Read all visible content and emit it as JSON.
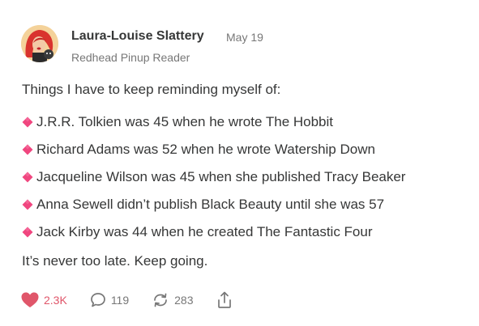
{
  "post": {
    "author": {
      "name": "Laura-Louise Slattery",
      "subtitle": "Redhead Pinup Reader",
      "avatar_icon": "pinup-avatar"
    },
    "date": "May 19",
    "intro": "Things I have to keep reminding myself of:",
    "bullet_icon": "pink-diamond-emoji",
    "facts": [
      "J.R.R. Tolkien was 45 when he wrote The Hobbit",
      "Richard Adams was 52 when he wrote Watership Down",
      "Jacqueline Wilson was 45 when she published Tracy Beaker",
      "Anna Sewell didn’t publish Black Beauty until she was 57",
      "Jack Kirby was 44 when he created The Fantastic Four"
    ],
    "outro": "It’s never too late. Keep going."
  },
  "actions": {
    "likes": "2.3K",
    "comments": "119",
    "restacks": "283",
    "like_icon": "heart-icon",
    "comment_icon": "comment-bubble-icon",
    "restack_icon": "restack-icon",
    "share_icon": "share-icon"
  },
  "colors": {
    "text": "#363737",
    "muted": "#777777",
    "like": "#e0566a",
    "diamond": "#f0467f"
  }
}
